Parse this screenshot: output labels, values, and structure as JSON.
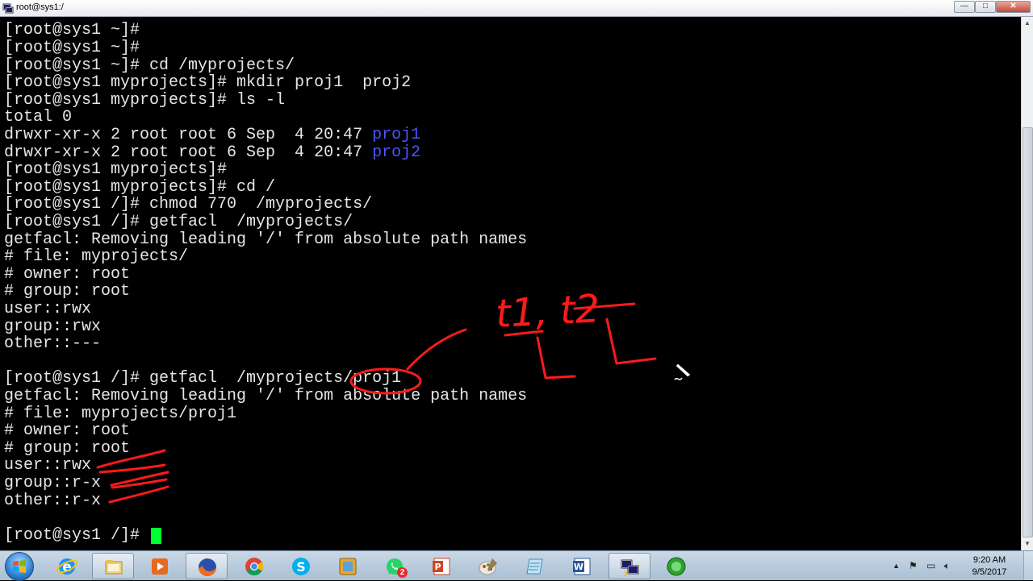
{
  "window": {
    "title": "root@sys1:/",
    "minimize_glyph": "—",
    "maximize_glyph": "□",
    "close_glyph": "✕"
  },
  "terminal": {
    "lines": [
      "[root@sys1 ~]#",
      "[root@sys1 ~]#",
      "[root@sys1 ~]# cd /myprojects/",
      "[root@sys1 myprojects]# mkdir proj1  proj2",
      "[root@sys1 myprojects]# ls -l",
      "total 0",
      "drwxr-xr-x 2 root root 6 Sep  4 20:47 ",
      "drwxr-xr-x 2 root root 6 Sep  4 20:47 ",
      "[root@sys1 myprojects]#",
      "[root@sys1 myprojects]# cd /",
      "[root@sys1 /]# chmod 770  /myprojects/",
      "[root@sys1 /]# getfacl  /myprojects/",
      "getfacl: Removing leading '/' from absolute path names",
      "# file: myprojects/",
      "# owner: root",
      "# group: root",
      "user::rwx",
      "group::rwx",
      "other::---",
      "",
      "[root@sys1 /]# getfacl  /myprojects/proj1",
      "getfacl: Removing leading '/' from absolute path names",
      "# file: myprojects/proj1",
      "# owner: root",
      "# group: root",
      "user::rwx",
      "group::r-x",
      "other::r-x",
      "",
      "[root@sys1 /]# "
    ],
    "dir_names": [
      "proj1",
      "proj2"
    ],
    "dir_color": "#4a55ff",
    "cursor_color": "#00ff33",
    "annotation_text": "t1, t2",
    "annotation_color": "#ff1a1a"
  },
  "taskbar": {
    "items": [
      {
        "name": "internet-explorer-icon",
        "active": false
      },
      {
        "name": "file-explorer-icon",
        "active": true
      },
      {
        "name": "media-player-icon",
        "active": false
      },
      {
        "name": "firefox-icon",
        "active": true
      },
      {
        "name": "chrome-icon",
        "active": false
      },
      {
        "name": "skype-icon",
        "active": false
      },
      {
        "name": "folder-app-icon",
        "active": false
      },
      {
        "name": "whatsapp-icon",
        "active": false
      },
      {
        "name": "powerpoint-icon",
        "active": false
      },
      {
        "name": "paint-icon",
        "active": false
      },
      {
        "name": "notepad-icon",
        "active": false
      },
      {
        "name": "word-icon",
        "active": false
      },
      {
        "name": "remote-desktop-icon",
        "active": true
      },
      {
        "name": "green-circle-app-icon",
        "active": false
      }
    ],
    "whatsapp_badge": "2",
    "clock_time": "9:20 AM",
    "clock_date": "9/5/2017"
  }
}
